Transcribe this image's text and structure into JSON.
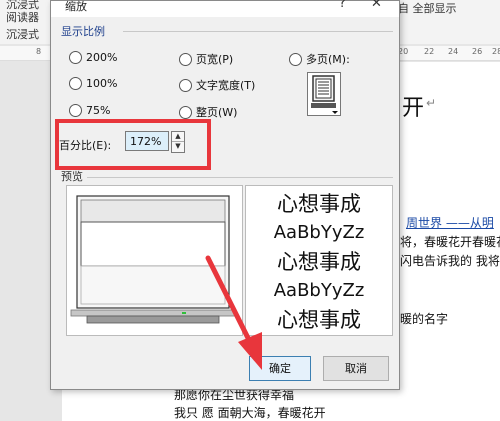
{
  "background": {
    "ribbon_left_lines": [
      "沉浸式",
      "阅读器",
      "沉浸式"
    ],
    "ribbon_right": "自 全部显示",
    "ruler_left_mark": "8",
    "ruler_marks": [
      "20",
      "22",
      "24",
      "26",
      "28"
    ],
    "doc_title_fragment": "开",
    "doc_lines": [
      "周世界 ——从明",
      "将，春暖花开春暖花",
      "闪电告诉我的 我将",
      "暖的名字",
      "那愿你在尘世获得幸福",
      "我只 愿 面朝大海，春暖花开"
    ],
    "paragraph_mark": "↵"
  },
  "dialog": {
    "title": "缩放",
    "help_label": "?",
    "close_label": "✕",
    "group_display": "显示比例",
    "options": [
      {
        "label": "200%",
        "mnemonic": "2"
      },
      {
        "label": "页宽(P)"
      },
      {
        "label": "多页(M):"
      },
      {
        "label": "100%",
        "mnemonic": "1"
      },
      {
        "label": "文字宽度(T)"
      },
      {
        "label": "75%",
        "mnemonic": "7"
      },
      {
        "label": "整页(W)"
      }
    ],
    "percent_label": "百分比(E):",
    "percent_value": "172%",
    "group_preview": "预览",
    "preview_lines": [
      "心想事成",
      "AaBbYyZz",
      "心想事成",
      "AaBbYyZz",
      "心想事成"
    ],
    "ok_label": "确定",
    "cancel_label": "取消",
    "highlight_color": "#e8363c"
  }
}
